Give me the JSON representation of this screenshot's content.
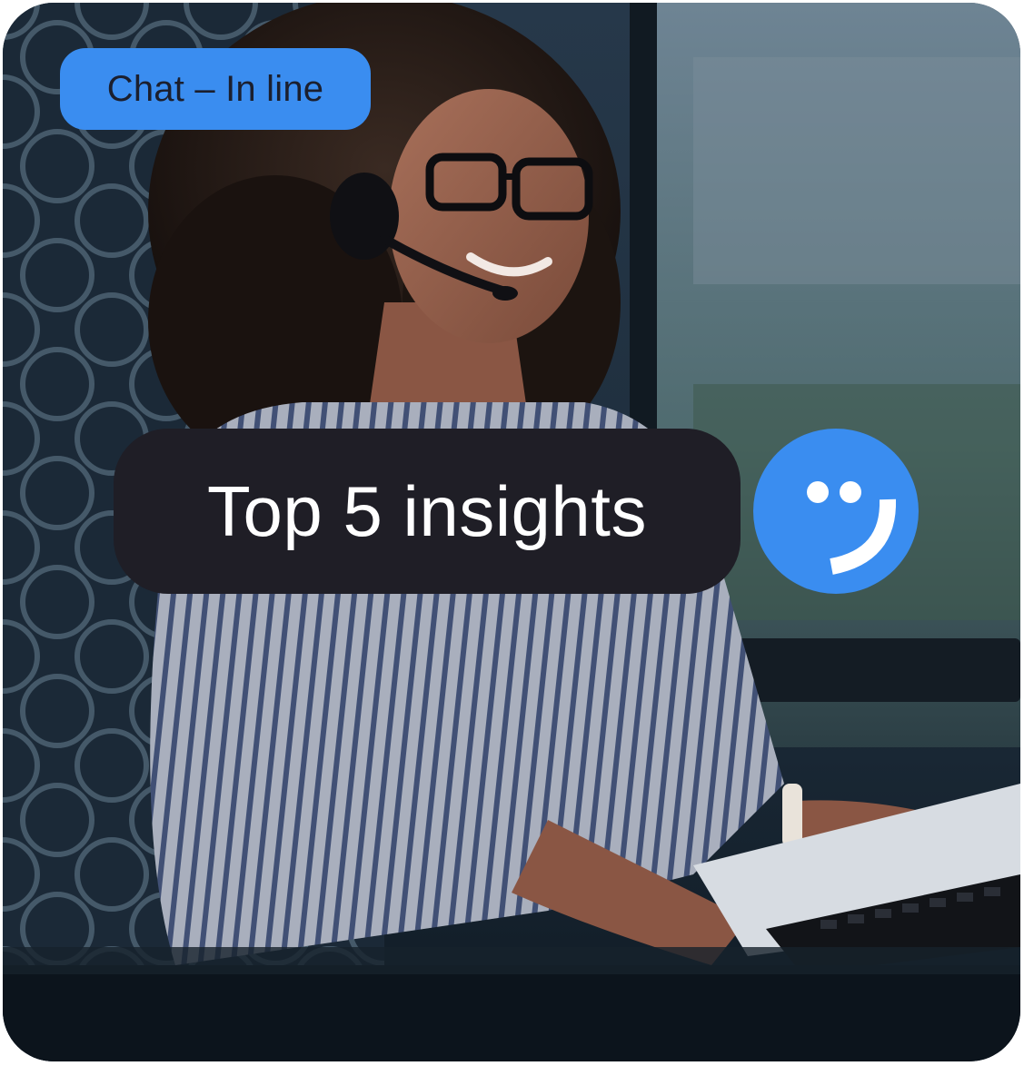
{
  "tag": {
    "label": "Chat – In line"
  },
  "headline": {
    "text": "Top 5 insights"
  },
  "icons": {
    "photo": "customer-service-agent-photo",
    "logo": "smiley-logo-icon"
  },
  "colors": {
    "accent_blue": "#3a8df0",
    "headline_bg": "#1f1e26",
    "tag_text": "#1b1f2e"
  }
}
